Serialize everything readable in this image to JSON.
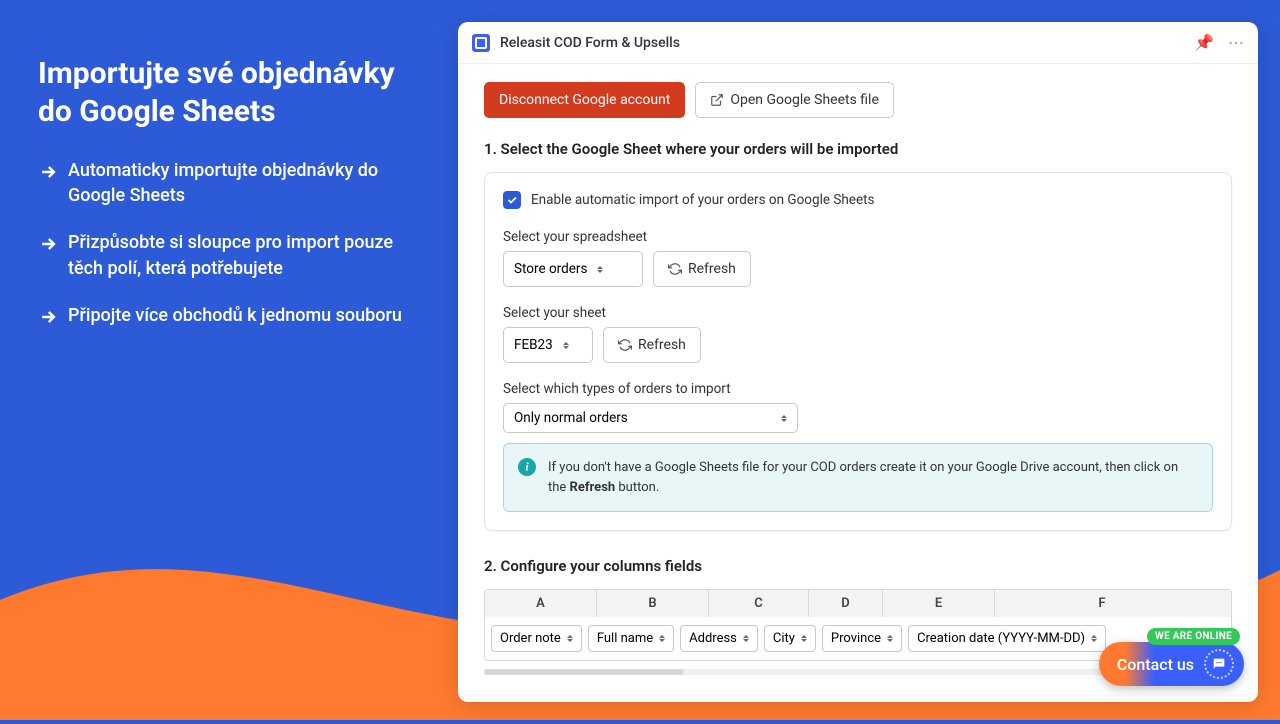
{
  "left": {
    "heading": "Importujte své objednávky do Google Sheets",
    "features": [
      "Automaticky importujte objednávky do Google Sheets",
      "Přizpůsobte si sloupce pro import pouze těch polí, která potřebujete",
      "Připojte více obchodů k jednomu souboru"
    ]
  },
  "app": {
    "title": "Releasit COD Form & Upsells",
    "buttons": {
      "disconnect": "Disconnect Google account",
      "open_sheets": "Open Google Sheets file"
    },
    "section1": {
      "title": "1. Select the Google Sheet where your orders will be imported",
      "enable_label": "Enable automatic import of your orders on Google Sheets",
      "spreadsheet": {
        "label": "Select your spreadsheet",
        "value": "Store orders",
        "refresh": "Refresh"
      },
      "sheet": {
        "label": "Select your sheet",
        "value": "FEB23",
        "refresh": "Refresh"
      },
      "types": {
        "label": "Select which types of orders to import",
        "value": "Only normal orders"
      },
      "info_prefix": "If you don't have a Google Sheets file for your COD orders create it on your Google Drive account, then click on the ",
      "info_bold": "Refresh",
      "info_suffix": " button."
    },
    "section2": {
      "title": "2. Configure your columns fields",
      "headers": [
        "A",
        "B",
        "C",
        "D",
        "E",
        "F"
      ],
      "fields": [
        "Order note",
        "Full name",
        "Address",
        "City",
        "Province",
        "Creation date (YYYY-MM-DD)"
      ]
    }
  },
  "chat": {
    "badge": "WE ARE ONLINE",
    "label": "Contact us"
  }
}
